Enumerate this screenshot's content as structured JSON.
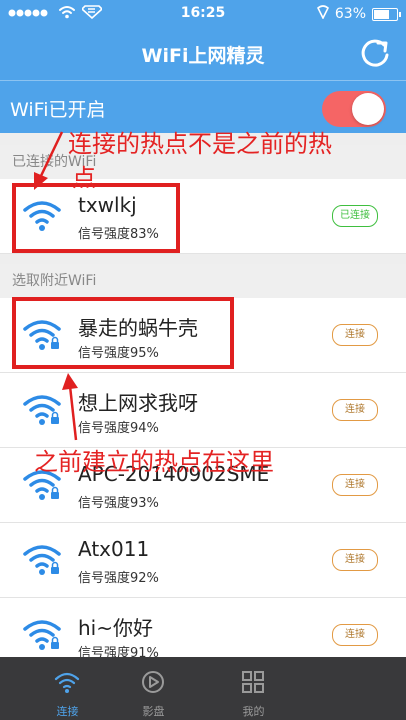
{
  "status_bar": {
    "time": "16:25",
    "battery": "63%",
    "battery_level": 0.63
  },
  "header": {
    "title": "WiFi上网精灵",
    "wifi_toggle_label": "WiFi已开启",
    "wifi_enabled": true
  },
  "connected_section": {
    "header": "已连接的WiFi",
    "network": {
      "name": "txwlkj",
      "strength": "信号强度83%",
      "button": "已连接"
    }
  },
  "nearby_section": {
    "header": "选取附近WiFi",
    "networks": [
      {
        "name": "暴走的蜗牛壳",
        "strength": "信号强度95%",
        "button": "连接"
      },
      {
        "name": "想上网求我呀",
        "strength": "信号强度94%",
        "button": "连接"
      },
      {
        "name": "APC-20140902SME",
        "strength": "信号强度93%",
        "button": "连接"
      },
      {
        "name": "Atx011",
        "strength": "信号强度92%",
        "button": "连接"
      },
      {
        "name": "hi~你好",
        "strength": "信号强度91%",
        "button": "连接"
      }
    ]
  },
  "annotations": {
    "top_line1": "连接的热点不是之前的热",
    "top_line2": "点",
    "bottom": "之前建立的热点在这里"
  },
  "tabs": [
    {
      "label": "连接",
      "active": true
    },
    {
      "label": "影盘",
      "active": false
    },
    {
      "label": "我的",
      "active": false
    }
  ],
  "colors": {
    "header_blue": "#4fa3ea",
    "toggle_on": "#f56565",
    "wifi_icon_blue": "#2d8be6",
    "annotation_red": "#e02020",
    "connected_green": "#3fbf3f",
    "connect_orange": "#e29a44",
    "tabbar_bg": "#39393b"
  }
}
